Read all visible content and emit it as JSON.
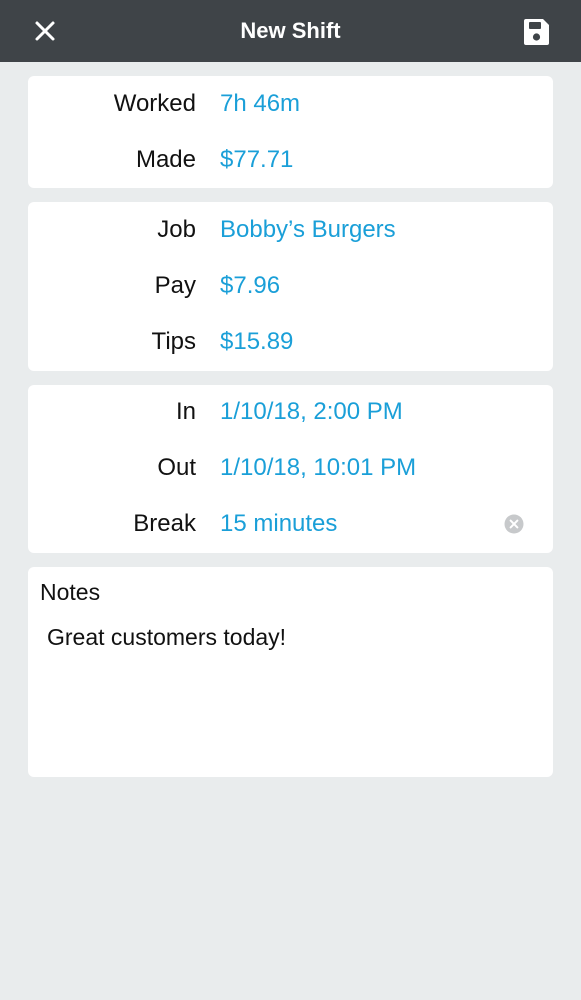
{
  "header": {
    "title": "New Shift",
    "close_icon": "close-icon",
    "save_icon": "floppy-disk-icon"
  },
  "summary": {
    "worked_label": "Worked",
    "worked_value": "7h 46m",
    "made_label": "Made",
    "made_value": "$77.71"
  },
  "job": {
    "job_label": "Job",
    "job_value": "Bobby’s Burgers",
    "pay_label": "Pay",
    "pay_value": "$7.96",
    "tips_label": "Tips",
    "tips_value": "$15.89"
  },
  "time": {
    "in_label": "In",
    "in_value": "1/10/18, 2:00 PM",
    "out_label": "Out",
    "out_value": "1/10/18, 10:01 PM",
    "break_label": "Break",
    "break_value": "15 minutes",
    "clear_icon": "clear-circle-icon"
  },
  "notes": {
    "heading": "Notes",
    "text": "Great customers today!"
  },
  "colors": {
    "header_bg": "#3f4448",
    "accent": "#1a9fd8",
    "background": "#e9eced",
    "card": "#ffffff"
  }
}
